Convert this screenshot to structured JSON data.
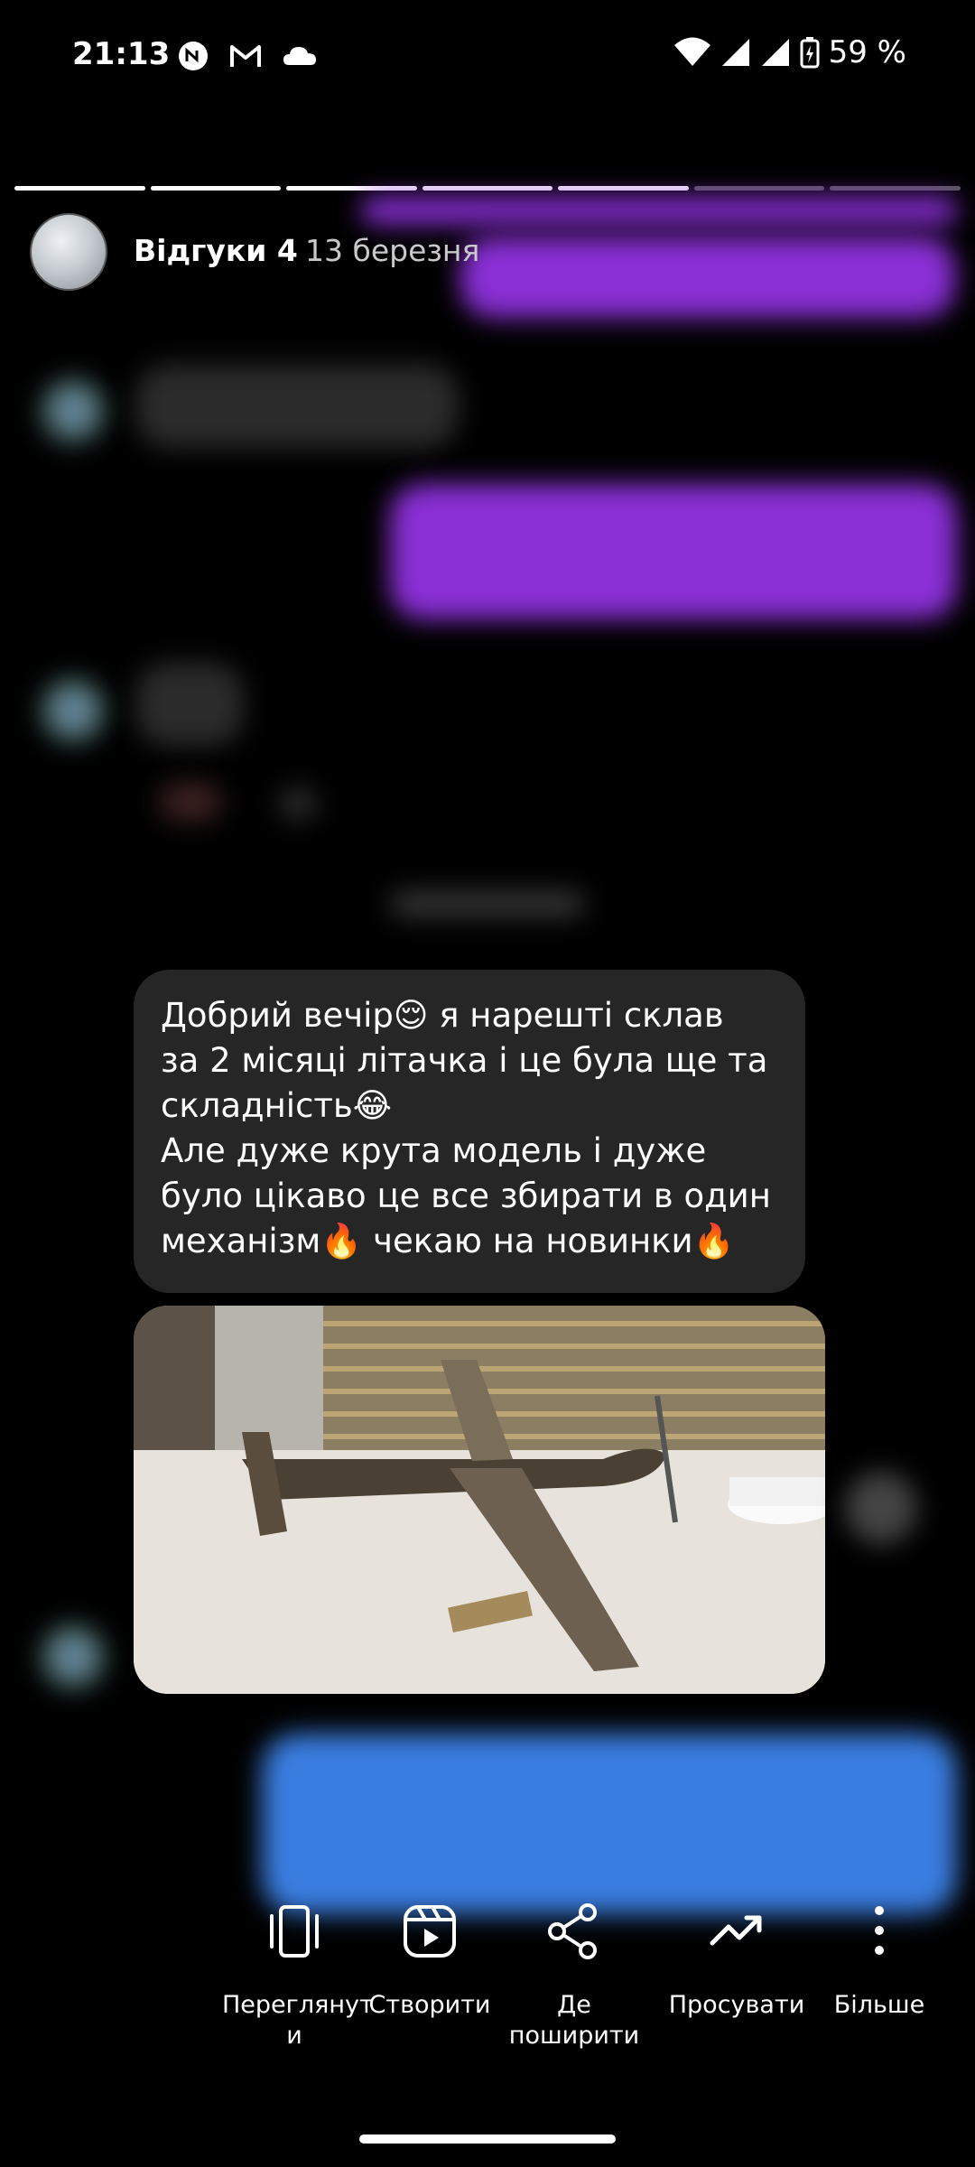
{
  "status_bar": {
    "time": "21:13",
    "battery": "59 %",
    "icons": [
      "nfc-icon",
      "gmail-icon",
      "cloud-icon",
      "wifi-icon",
      "signal-icon",
      "battery-icon"
    ]
  },
  "story": {
    "segments_total": 7,
    "segments_complete": 5,
    "author": "Відгуки 4",
    "date": "13 березня"
  },
  "message": {
    "text": "Добрий вечір😌 я нарешті склав\nза 2 місяці літачка і це була ще та\nскладність😂\nАле дуже крута модель і дуже\nбуло цікаво це все збирати в один\nмеханізм🔥 чекаю на новинки🔥"
  },
  "actions": [
    {
      "icon": "view-icon",
      "label": "Переглянут\nи"
    },
    {
      "icon": "create-reel-icon",
      "label": "Створити"
    },
    {
      "icon": "share-icon",
      "label": "Де\nпоширити"
    },
    {
      "icon": "promote-icon",
      "label": "Просувати"
    },
    {
      "icon": "more-icon",
      "label": "Більше"
    }
  ],
  "colors": {
    "outgoing_bubble": "#8a2fd6",
    "blue_bubble": "#3a7de0",
    "incoming_bubble": "#262626"
  }
}
